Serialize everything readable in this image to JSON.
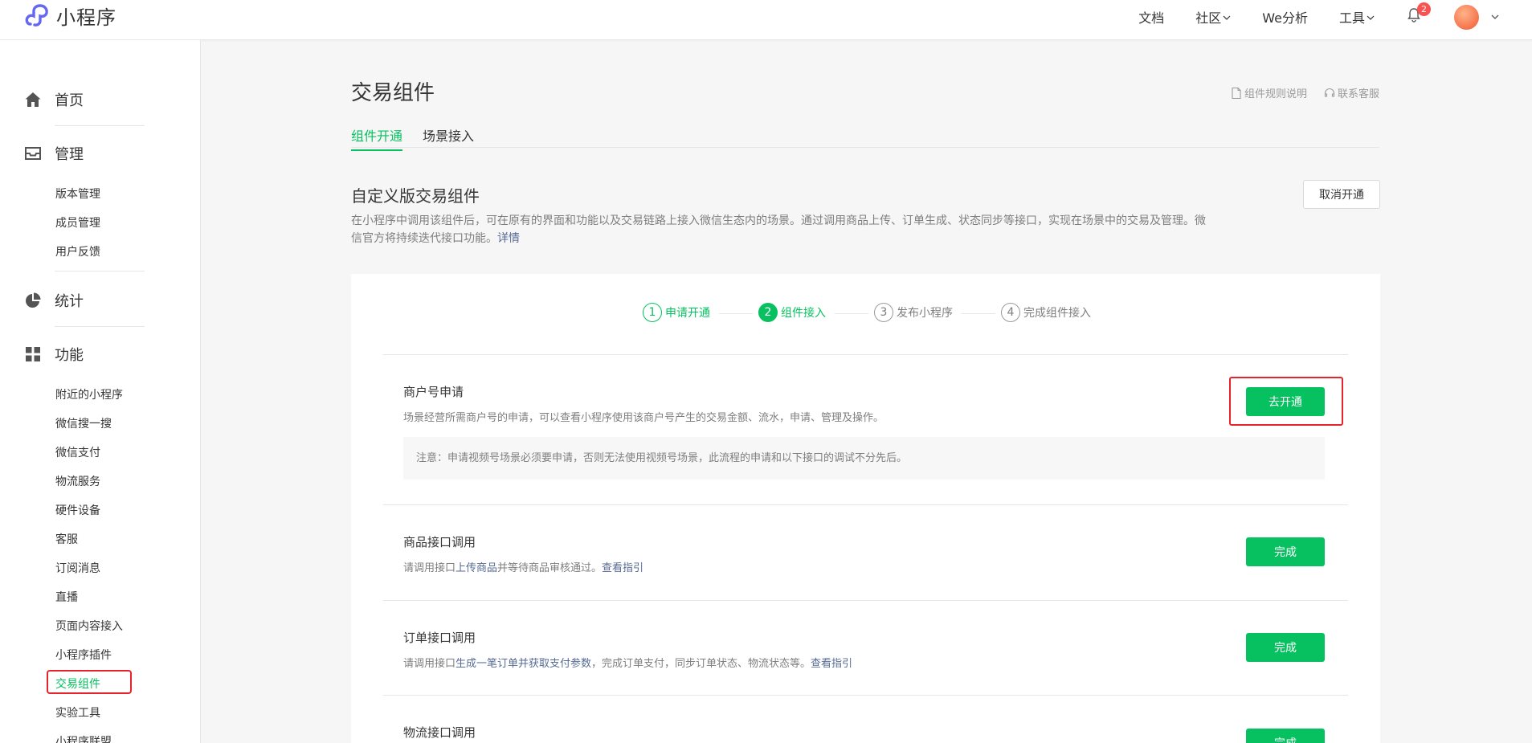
{
  "app": {
    "name": "小程序",
    "brand_color": "#07c160"
  },
  "header": {
    "nav": [
      {
        "label": "文档",
        "dropdown": false
      },
      {
        "label": "社区",
        "dropdown": true
      },
      {
        "label": "We分析",
        "dropdown": false
      },
      {
        "label": "工具",
        "dropdown": true
      }
    ],
    "notification_count": "2"
  },
  "sidebar": {
    "groups": [
      {
        "label": "首页",
        "icon": "home-icon"
      },
      {
        "label": "管理",
        "icon": "inbox-icon"
      },
      {
        "label": "统计",
        "icon": "pie-chart-icon"
      },
      {
        "label": "功能",
        "icon": "grid-icon"
      }
    ],
    "manage_items": [
      "版本管理",
      "成员管理",
      "用户反馈"
    ],
    "feature_items": [
      "附近的小程序",
      "微信搜一搜",
      "微信支付",
      "物流服务",
      "硬件设备",
      "客服",
      "订阅消息",
      "直播",
      "页面内容接入",
      "小程序插件",
      "交易组件",
      "实验工具",
      "小程序联盟"
    ],
    "active_item": "交易组件"
  },
  "main": {
    "title": "交易组件",
    "links": {
      "rules": "组件规则说明",
      "support": "联系客服"
    },
    "tabs": [
      {
        "label": "组件开通",
        "active": true
      },
      {
        "label": "场景接入",
        "active": false
      }
    ],
    "section": {
      "title": "自定义版交易组件",
      "desc": "在小程序中调用该组件后，可在原有的界面和功能以及交易链路上接入微信生态内的场景。通过调用商品上传、订单生成、状态同步等接口，实现在场景中的交易及管理。微信官方将持续迭代接口功能。",
      "desc_link": "详情",
      "cancel_label": "取消开通"
    },
    "steps": [
      {
        "num": "1",
        "label": "申请开通",
        "state": "done"
      },
      {
        "num": "2",
        "label": "组件接入",
        "state": "current"
      },
      {
        "num": "3",
        "label": "发布小程序",
        "state": "pending"
      },
      {
        "num": "4",
        "label": "完成组件接入",
        "state": "pending"
      }
    ],
    "items": {
      "merchant": {
        "title": "商户号申请",
        "desc": "场景经营所需商户号的申请，可以查看小程序使用该商户号产生的交易金额、流水，申请、管理及操作。",
        "note": "注意：申请视频号场景必须要申请，否则无法使用视频号场景，此流程的申请和以下接口的调试不分先后。",
        "button": "去开通"
      },
      "product": {
        "title": "商品接口调用",
        "desc_pre": "请调用接口",
        "desc_hl": "上传商品",
        "desc_post": "并等待商品审核通过。",
        "link": "查看指引",
        "button": "完成"
      },
      "order": {
        "title": "订单接口调用",
        "desc_pre": "请调用接口",
        "desc_hl": "生成一笔订单并获取支付参数",
        "desc_post": "，完成订单支付，同步订单状态、物流状态等。",
        "link": "查看指引",
        "button": "完成"
      },
      "logistics": {
        "title": "物流接口调用",
        "button": "完成"
      }
    }
  }
}
